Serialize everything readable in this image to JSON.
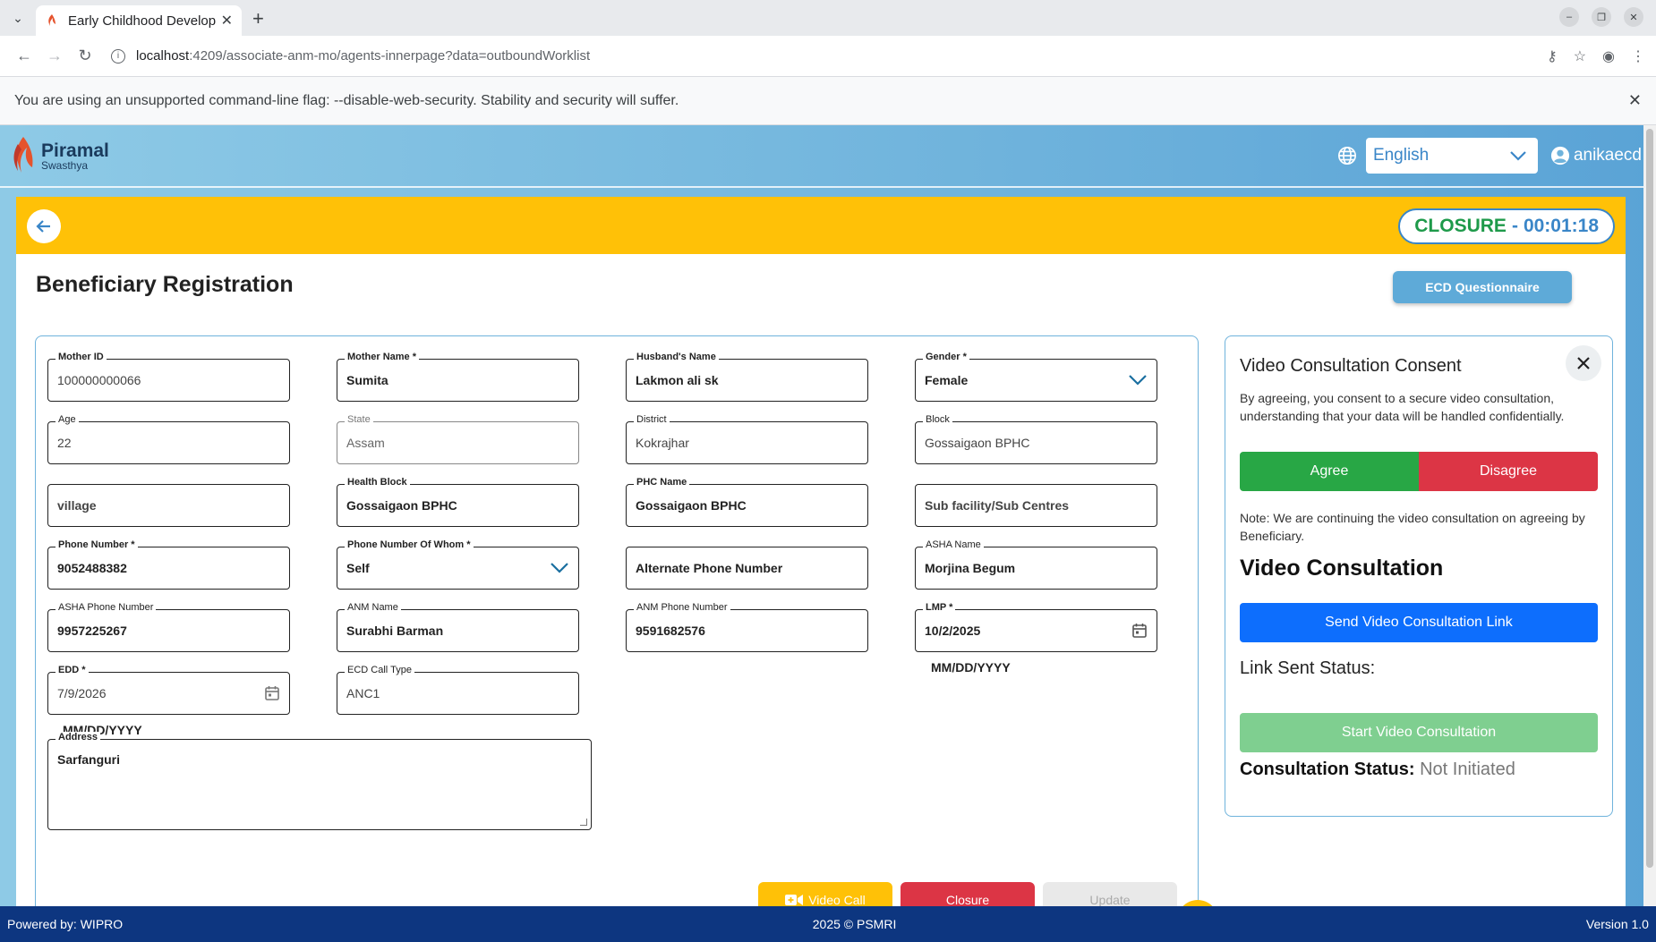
{
  "browser": {
    "tab_title": "Early Childhood Develop",
    "url_host": "localhost",
    "url_path": ":4209/associate-anm-mo/agents-innerpage?data=outboundWorklist",
    "infobar_message": "You are using an unsupported command-line flag: --disable-web-security. Stability and security will suffer."
  },
  "header": {
    "logo_line1": "Piramal",
    "logo_line2": "Swasthya",
    "language": "English",
    "username": "anikaecd"
  },
  "callbar": {
    "status_label": "CLOSURE",
    "separator": "-",
    "timer": "00:01:18"
  },
  "page": {
    "title": "Beneficiary Registration",
    "ecd_button": "ECD Questionnaire"
  },
  "form": {
    "mother_id": {
      "label": "Mother ID",
      "value": "100000000066"
    },
    "mother_name": {
      "label": "Mother Name *",
      "value": "Sumita"
    },
    "husband_name": {
      "label": "Husband's Name",
      "value": "Lakmon ali sk"
    },
    "gender": {
      "label": "Gender *",
      "value": "Female"
    },
    "age": {
      "label": "Age",
      "value": "22"
    },
    "state": {
      "label": "State",
      "value": "Assam"
    },
    "district": {
      "label": "District",
      "value": "Kokrajhar"
    },
    "block": {
      "label": "Block",
      "value": "Gossaigaon BPHC"
    },
    "village": {
      "placeholder": "village"
    },
    "health_block": {
      "label": "Health Block",
      "value": "Gossaigaon BPHC"
    },
    "phc_name": {
      "label": "PHC Name",
      "value": "Gossaigaon BPHC"
    },
    "sub_facility": {
      "placeholder": "Sub facility/Sub Centres"
    },
    "phone_number": {
      "label": "Phone Number *",
      "value": "9052488382"
    },
    "phone_of_whom": {
      "label": "Phone Number Of Whom *",
      "value": "Self"
    },
    "alternate_phone": {
      "placeholder": "Alternate Phone Number"
    },
    "asha_name": {
      "label": "ASHA Name",
      "value": "Morjina Begum"
    },
    "asha_phone": {
      "label": "ASHA Phone Number",
      "value": "9957225267"
    },
    "anm_name": {
      "label": "ANM Name",
      "value": "Surabhi Barman"
    },
    "anm_phone": {
      "label": "ANM Phone Number",
      "value": "9591682576"
    },
    "lmp": {
      "label": "LMP *",
      "value": "10/2/2025",
      "hint": "MM/DD/YYYY"
    },
    "edd": {
      "label": "EDD *",
      "value": "7/9/2026",
      "hint": "MM/DD/YYYY"
    },
    "ecd_call_type": {
      "label": "ECD Call Type",
      "value": "ANC1"
    },
    "address": {
      "label": "Address",
      "value": "Sarfanguri"
    }
  },
  "actions": {
    "video_call": "Video Call",
    "closure": "Closure",
    "update": "Update"
  },
  "consent": {
    "title": "Video Consultation Consent",
    "text": "By agreeing, you consent to a secure video consultation, understanding that your data will be handled confidentially.",
    "agree": "Agree",
    "disagree": "Disagree",
    "note": "Note: We are continuing the video consultation on agreeing by Beneficiary.",
    "vc_title": "Video Consultation",
    "send_link": "Send Video Consultation Link",
    "link_status": "Link Sent Status:",
    "start": "Start Video Consultation",
    "status_label": "Consultation Status:",
    "status_value": "Not Initiated"
  },
  "footer": {
    "left": "Powered by: WIPRO",
    "center": "2025 © PSMRI",
    "right": "Version 1.0"
  },
  "colors": {
    "accent_yellow": "#ffc107",
    "primary_blue": "#0d6efd",
    "agree_green": "#28a745",
    "disagree_red": "#dc3545",
    "footer_navy": "#0d3680"
  }
}
